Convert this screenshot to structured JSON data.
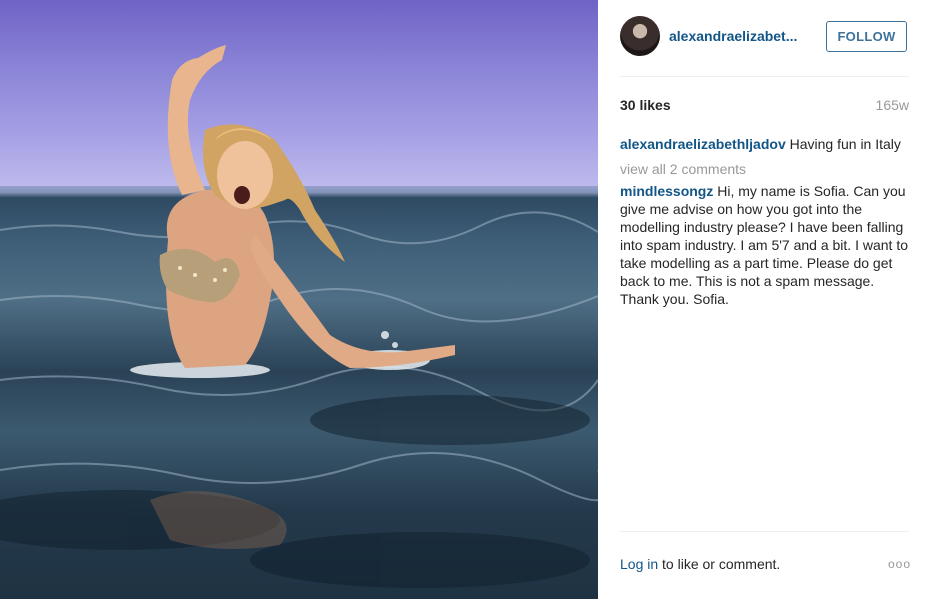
{
  "post": {
    "username_short": "alexandraelizabet...",
    "follow_label": "FOLLOW",
    "likes": "30 likes",
    "age": "165w",
    "caption_user": "alexandraelizabethljadov",
    "caption_text": " Having fun in Italy",
    "view_all": "view all 2 comments",
    "comment_user": "mindlessongz",
    "comment_text": " Hi, my name is Sofia. Can you give me advise on how you got into the modelling industry please? I have been falling into spam industry. I am 5'7 and a bit. I want to take modelling as a part time. Please do get back to me. This is not a spam message. Thank you. Sofia.",
    "login_link": "Log in",
    "login_rest": " to like or comment.",
    "more_glyph": "ooo"
  },
  "icons": {
    "avatar": "profile-avatar",
    "more": "more-options-icon"
  },
  "colors": {
    "link": "#125688",
    "follow_border": "#3f729b",
    "muted": "#999999"
  }
}
